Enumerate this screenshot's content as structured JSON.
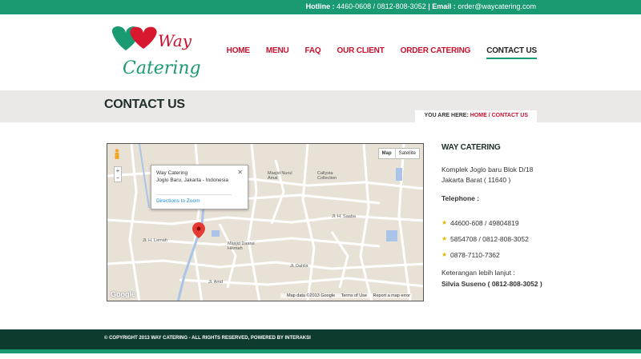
{
  "topbar": {
    "hotline_label": "Hotline :",
    "hotline_value": "4460-0608 / 0812-808-3052",
    "separator": "|",
    "email_label": "Email :",
    "email_value": "order@waycatering.com"
  },
  "logo": {
    "top_text": "Way",
    "bottom_text": "Catering"
  },
  "nav": {
    "items": [
      {
        "label": "HOME"
      },
      {
        "label": "MENU"
      },
      {
        "label": "FAQ"
      },
      {
        "label": "OUR CLIENT"
      },
      {
        "label": "ORDER CATERING"
      },
      {
        "label": "CONTACT US"
      }
    ]
  },
  "page": {
    "title": "CONTACT US",
    "breadcrumb_prefix": "YOU ARE HERE:",
    "breadcrumb_home": "HOME",
    "breadcrumb_sep": "/",
    "breadcrumb_current": "CONTACT US"
  },
  "map": {
    "type_map": "Map",
    "type_satellite": "Satellite",
    "popup_title": "Way Catering",
    "popup_address": "Joglo Baru, Jakarta - Indonesia",
    "popup_links": "Directions to  Zoom",
    "zoom_in": "+",
    "zoom_out": "−",
    "google": "Google",
    "footer_data": "Map data ©2013 Google",
    "footer_terms": "Terms of Use",
    "footer_report": "Report a map error",
    "labels": {
      "masjid_nurul": "Masjid Nurul Amal",
      "callysta": "Callysta Collection",
      "masjid_daarul": "Masjid Daarul Hikmah",
      "saaba": "Jl. H. Saaba",
      "amd": "Jl. Amd",
      "dahlia": "Jl. Dahlia",
      "lemah": "Jl. H. Lemah"
    }
  },
  "sidebar": {
    "heading": "WAY CATERING",
    "address": "Komplek Joglo baru Blok D/18 Jakarta Barat ( 11640 )",
    "telephone_label": "Telephone :",
    "phones": [
      "44600-608 / 49804819",
      "5854708 / 0812-808-3052",
      "0878-7110-7362"
    ],
    "info_label": "Keterangan lebih lanjut :",
    "contact_person": "Silvia Suseno ( 0812-808-3052 )"
  },
  "footer": {
    "copyright": "© COPYRIGHT 2013 WAY CATERING - ALL RIGHTS RESERVED, POWERED BY INTERAKSI"
  },
  "colors": {
    "primary_green": "#1a9a73",
    "nav_red": "#c8102e",
    "footer_dark": "#0e3b30",
    "title_bar": "#ebe8e8"
  }
}
